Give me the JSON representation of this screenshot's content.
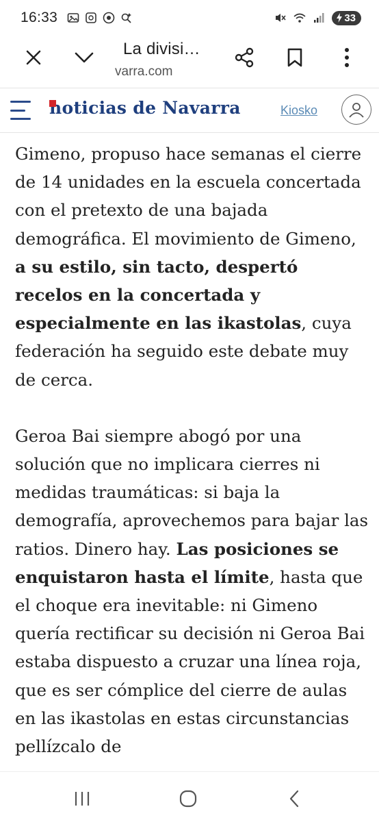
{
  "status_bar": {
    "time": "16:33",
    "battery": "33",
    "left_icons": [
      "gallery-icon",
      "square-icon",
      "chrome-icon",
      "assistant-icon"
    ],
    "right_icons": [
      "mute-icon",
      "wifi-icon",
      "signal-icon",
      "battery-icon"
    ]
  },
  "toolbar": {
    "title": "La divisi…",
    "url": "varra.com"
  },
  "site": {
    "logo_text": "noticias de Navarra",
    "kiosko_label": "Kiosko"
  },
  "article": {
    "p1": {
      "t1": "Gimeno, propuso hace semanas el cierre de 14 unidades en la escuela concertada con el pretexto de una bajada demográfica. El movimiento de Gimeno, ",
      "b1": "a su estilo, sin tacto, despertó recelos en la concertada y especialmente en las ikastolas",
      "t2": ", cuya federación ha seguido este debate muy de cerca."
    },
    "p2": {
      "t1": "Geroa Bai siempre abogó por una solución que no implicara cierres ni medidas traumáticas: si baja la demografía, aprovechemos para bajar las ratios. Dinero hay. ",
      "b1": "Las posiciones se enquistaron hasta el límite",
      "t2": ", hasta que el choque era inevitable: ni Gimeno quería rectificar su decisión ni Geroa Bai estaba dispuesto a cruzar una línea roja, que es ser cómplice del cierre de aulas en las ikastolas en estas circunstancias pellízcalo de"
    }
  }
}
